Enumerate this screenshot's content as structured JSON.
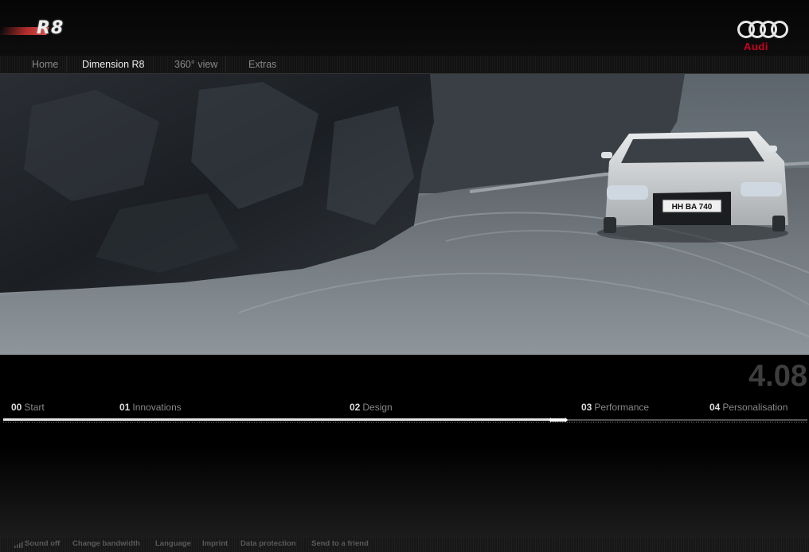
{
  "header": {
    "model_logo_text": "R8",
    "brand_logo_text": "Audi"
  },
  "nav": {
    "items": [
      {
        "label": "Home"
      },
      {
        "label": "Dimension R8",
        "active": true
      },
      {
        "label": "360° view"
      },
      {
        "label": "Extras"
      }
    ]
  },
  "hero": {
    "license_plate": "HH BA 740"
  },
  "video": {
    "time": "4.08",
    "progress": 0.69,
    "chapters": [
      {
        "num": "00",
        "label": "Start"
      },
      {
        "num": "01",
        "label": "Innovations"
      },
      {
        "num": "02",
        "label": "Design"
      },
      {
        "num": "03",
        "label": "Performance"
      },
      {
        "num": "04",
        "label": "Personalisation"
      }
    ]
  },
  "footer": {
    "sound_icon": "speaker-bars-icon",
    "links": [
      {
        "label": "Sound off"
      },
      {
        "label": "Change bandwidth"
      },
      {
        "label": "Language"
      },
      {
        "label": "Imprint"
      },
      {
        "label": "Data protection"
      },
      {
        "label": "Send to a friend"
      }
    ]
  },
  "colors": {
    "brand_red": "#cc0022",
    "background": "#000000",
    "progress": "#e6e6e6"
  }
}
